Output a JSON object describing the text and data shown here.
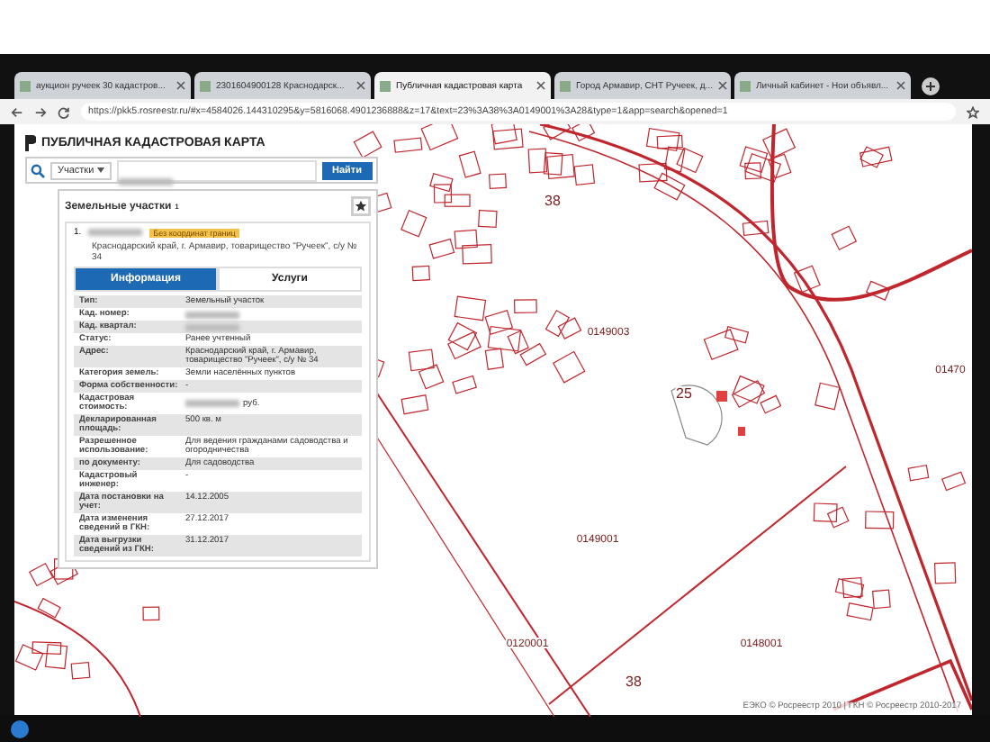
{
  "browser": {
    "tabs": [
      {
        "title": "аукцион ручеек 30 кадастров...",
        "selected": false
      },
      {
        "title": "2301604900128 Краснодарск...",
        "selected": false
      },
      {
        "title": "Публичная кадастровая карта",
        "selected": true
      },
      {
        "title": "Город Армавир, СНТ Ручеек, д...",
        "selected": false
      },
      {
        "title": "Личный кабинет - Нои объявл...",
        "selected": false
      }
    ],
    "url": "https://pkk5.rosreestr.ru/#x=4584026.144310295&y=5816068.4901236888&z=17&text=23%3A38%3A0149001%3A28&type=1&app=search&opened=1"
  },
  "panel": {
    "title": "ПУБЛИЧНАЯ КАДАСТРОВАЯ КАРТА",
    "search": {
      "category": "Участки",
      "search_button": "Найти"
    },
    "results_title": "Земельные участки",
    "results_count": "1",
    "result": {
      "index": "1.",
      "badge": "Без координат границ",
      "address": "Краснодарский край, г. Армавир, товарищество \"Ручеек\", с/у № 34",
      "tabs": [
        {
          "label": "Информация",
          "selected": true
        },
        {
          "label": "Услуги",
          "selected": false
        }
      ],
      "rows": [
        {
          "label": "Тип:",
          "value": "Земельный участок",
          "redacted": false
        },
        {
          "label": "Кад. номер:",
          "redacted": true
        },
        {
          "label": "Кад. квартал:",
          "redacted": true
        },
        {
          "label": "Статус:",
          "value": "Ранее учтенный",
          "redacted": false
        },
        {
          "label": "Адрес:",
          "value": "Краснодарский край, г. Армавир, товарищество \"Ручеек\", с/у № 34",
          "redacted": false
        },
        {
          "label": "Категория земель:",
          "value": "Земли населённых пунктов",
          "redacted": false
        },
        {
          "label": "Форма собственности:",
          "value": "-",
          "redacted": false
        },
        {
          "label": "Кадастровая стоимость:",
          "value": "руб.",
          "redacted": true
        },
        {
          "label": "Декларированная площадь:",
          "value": "500 кв. м",
          "redacted": false
        },
        {
          "label": "Разрешенное использование:",
          "value": "Для ведения гражданами садоводства и огородничества",
          "redacted": false
        },
        {
          "label": "по документу:",
          "value": "Для садоводства",
          "redacted": false
        },
        {
          "label": "Кадастровый инженер:",
          "value": "-",
          "redacted": false
        },
        {
          "label": "Дата постановки на учет:",
          "value": "14.12.2005",
          "redacted": false
        },
        {
          "label": "Дата изменения сведений в ГКН:",
          "value": "27.12.2017",
          "redacted": false
        },
        {
          "label": "Дата выгрузки сведений из ГКН:",
          "value": "31.12.2017",
          "redacted": false
        }
      ]
    }
  },
  "map": {
    "labels": [
      "38",
      "0149003",
      "25",
      "01470",
      "0149001",
      "0120001",
      "0148001",
      "38"
    ],
    "attribution": "ЕЭКО © Росреестр 2010 | ГКН © Росреестр 2010-2017"
  }
}
